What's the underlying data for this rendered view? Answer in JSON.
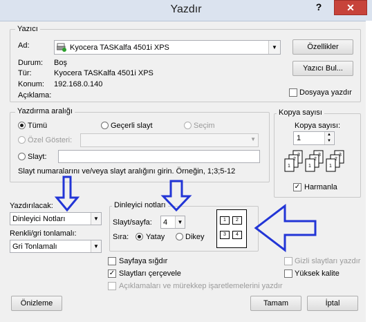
{
  "window": {
    "title": "Yazdır",
    "help": "?",
    "close": "✕"
  },
  "printer": {
    "group_label": "Yazıcı",
    "name_label": "Ad:",
    "name_value": "Kyocera TASKalfa 4501i XPS",
    "status_label": "Durum:",
    "status_value": "Boş",
    "type_label": "Tür:",
    "type_value": "Kyocera TASKalfa 4501i XPS",
    "location_label": "Konum:",
    "location_value": "192.168.0.140",
    "comment_label": "Açıklama:",
    "properties_button": "Özellikler",
    "find_printer_button": "Yazıcı Bul...",
    "print_to_file_label": "Dosyaya yazdır"
  },
  "range": {
    "group_label": "Yazdırma aralığı",
    "all_label": "Tümü",
    "current_slide_label": "Geçerli slayt",
    "selection_label": "Seçim",
    "custom_show_label": "Özel Gösteri:",
    "slides_label": "Slayt:",
    "hint": "Slayt numaralarını ve/veya slayt aralığını girin. Örneğin, 1;3;5-12"
  },
  "copies": {
    "group_label": "Kopya sayısı",
    "count_label": "Kopya sayısı:",
    "count_value": "1",
    "collate_label": "Harmanla"
  },
  "print_what": {
    "label": "Yazdırılacak:",
    "value": "Dinleyici Notları"
  },
  "color": {
    "label": "Renkli/gri tonlamalı:",
    "value": "Gri Tonlamalı"
  },
  "handouts": {
    "group_label": "Dinleyici notları",
    "slides_per_page_label": "Slayt/sayfa:",
    "slides_per_page_value": "4",
    "order_label": "Sıra:",
    "horizontal_label": "Yatay",
    "vertical_label": "Dikey",
    "preview_numbers": [
      "1",
      "2",
      "3",
      "4"
    ]
  },
  "options": {
    "scale_to_fit": "Sayfaya sığdır",
    "frame_slides": "Slaytları çerçevele",
    "comments_ink": "Açıklamaları ve mürekkep işaretlemelerini yazdır",
    "hidden_slides": "Gizli slaytları yazdır",
    "high_quality": "Yüksek kalite"
  },
  "buttons": {
    "preview": "Önizleme",
    "ok": "Tamam",
    "cancel": "İptal"
  },
  "colors": {
    "arrow": "#2235d6",
    "titlebar": "#dbe3ef",
    "close": "#c7433a"
  }
}
